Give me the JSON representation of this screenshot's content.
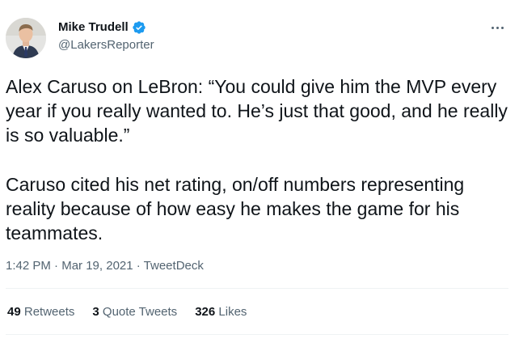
{
  "author": {
    "display_name": "Mike Trudell",
    "handle": "@LakersReporter",
    "verified": true
  },
  "tweet": {
    "paragraphs": [
      "Alex Caruso on LeBron: “You could give him the MVP every year if you really wanted to. He’s just that good, and he really is so valuable.”",
      "Caruso cited his net rating, on/off numbers representing reality because of how easy he makes the game for his teammates."
    ]
  },
  "meta": {
    "time": "1:42 PM",
    "separator": " · ",
    "date": "Mar 19, 2021",
    "source": "TweetDeck"
  },
  "stats": {
    "retweets": {
      "count": "49",
      "label": "Retweets"
    },
    "quote_tweets": {
      "count": "3",
      "label": "Quote Tweets"
    },
    "likes": {
      "count": "326",
      "label": "Likes"
    }
  },
  "icons": {
    "verified": "verified-badge-icon",
    "more": "more-options-icon"
  },
  "colors": {
    "verified": "#1d9bf0",
    "text_primary": "#0f1419",
    "text_secondary": "#536471",
    "divider": "#eff3f4"
  }
}
